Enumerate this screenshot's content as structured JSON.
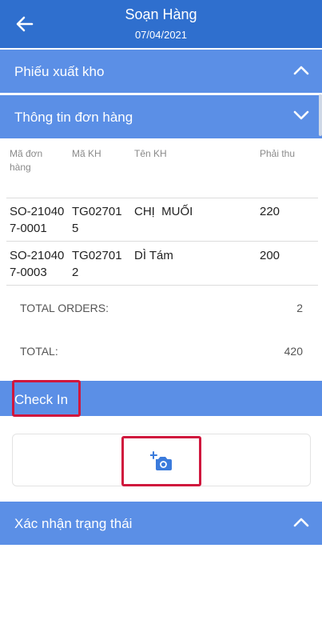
{
  "header": {
    "title": "Soạn Hàng",
    "date": "07/04/2021"
  },
  "sections": {
    "export_slip": "Phiếu xuất kho",
    "order_info": "Thông tin đơn hàng",
    "check_in": "Check In",
    "status_confirm": "Xác nhận trạng thái"
  },
  "table": {
    "headers": {
      "order_code": "Mã đơn hàng",
      "customer_code": "Mã KH",
      "customer_name": "Tên KH",
      "receivable": "Phải thu"
    },
    "rows": [
      {
        "order_code": "SO-210407-0001",
        "customer_code": "TG027015",
        "customer_name": "CHỊ  MUỐI",
        "receivable": "220"
      },
      {
        "order_code": "SO-210407-0003",
        "customer_code": "TG027012",
        "customer_name": "DÌ Tám",
        "receivable": "200"
      }
    ]
  },
  "summary": {
    "total_orders_label": "TOTAL ORDERS:",
    "total_orders_value": "2",
    "total_label": "TOTAL:",
    "total_value": "420"
  },
  "colors": {
    "header": "#2f6fce",
    "section": "#5b8fe6",
    "highlight": "#d0173d"
  },
  "icons": [
    "back-arrow-icon",
    "chevron-up-icon",
    "chevron-down-icon",
    "add-photo-icon"
  ]
}
